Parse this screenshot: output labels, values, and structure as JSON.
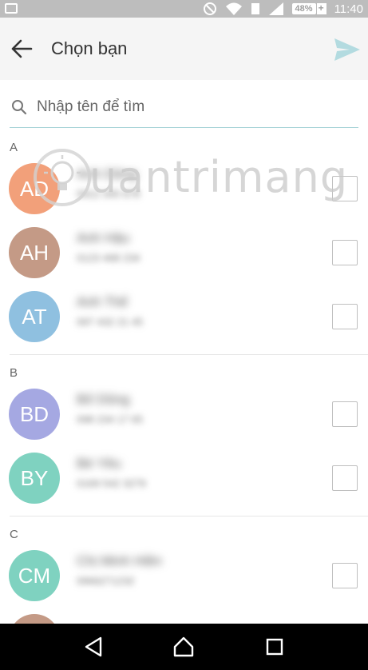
{
  "status_bar": {
    "battery": "48%",
    "time": "11:40"
  },
  "toolbar": {
    "title": "Chọn bạn"
  },
  "search": {
    "placeholder": "Nhập tên để tìm"
  },
  "sections": [
    {
      "letter": "A",
      "contacts": [
        {
          "initials": "AD",
          "name": "Anh Dũng",
          "phone": "0912 345 678",
          "color": "#f2a07a"
        },
        {
          "initials": "AH",
          "name": "Anh Hậu",
          "phone": "0123 468 234",
          "color": "#c49a86"
        },
        {
          "initials": "AT",
          "name": "Anh Thế",
          "phone": "097 432 21 45",
          "color": "#8fc0e0"
        }
      ]
    },
    {
      "letter": "B",
      "contacts": [
        {
          "initials": "BD",
          "name": "Bố Dũng",
          "phone": "098 234 17 65",
          "color": "#a5a8e2"
        },
        {
          "initials": "BY",
          "name": "Bé Yêu",
          "phone": "0169 542 3279",
          "color": "#7fd2c0"
        }
      ]
    },
    {
      "letter": "C",
      "contacts": [
        {
          "initials": "CM",
          "name": "Chị Minh Hiền",
          "phone": "0966271232",
          "color": "#7fd2c0"
        }
      ]
    }
  ],
  "watermark": {
    "text": "uantrimang"
  },
  "colors": {
    "accent_send": "#b3dbe0",
    "search_underline": "#a8d4d8"
  }
}
